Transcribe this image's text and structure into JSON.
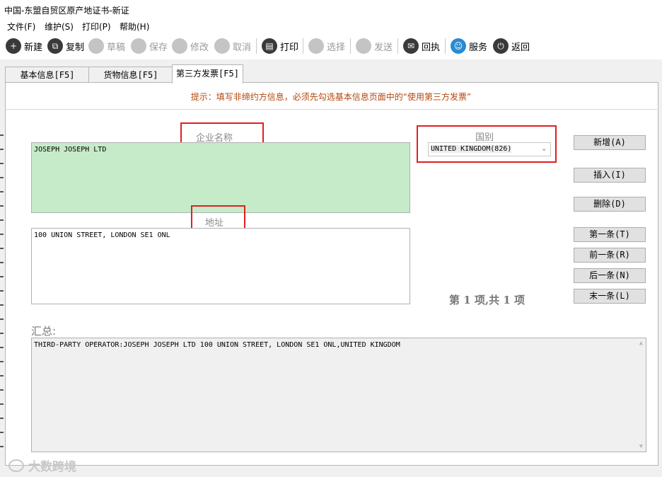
{
  "window": {
    "title": "中国-东盟自贸区原产地证书-新证"
  },
  "menu": [
    "文件(F)",
    "维护(S)",
    "打印(P)",
    "帮助(H)"
  ],
  "toolbar": {
    "new": "新建",
    "copy": "复制",
    "draft": "草稿",
    "save": "保存",
    "edit": "修改",
    "cancel": "取消",
    "print": "打印",
    "select": "选择",
    "send": "发送",
    "receipt": "回执",
    "service": "服务",
    "back": "返回"
  },
  "tabs": [
    "基本信息[F5]",
    "货物信息[F5]",
    "第三方发票[F5]"
  ],
  "hint": "提示：填写非缔约方信息，必须先勾选基本信息页面中的“使用第三方发票”",
  "form": {
    "company_label": "企业名称",
    "company_value": "JOSEPH JOSEPH LTD",
    "address_label": "地址",
    "address_value": "100 UNION STREET, LONDON SE1 ONL",
    "country_label": "国别",
    "country_value": "UNITED KINGDOM(826)"
  },
  "buttons": {
    "add": "新增(A)",
    "insert": "插入(I)",
    "delete": "删除(D)",
    "first": "第一条(T)",
    "prev": "前一条(R)",
    "next": "后一条(N)",
    "last": "末一条(L)"
  },
  "pager": "第 1 项,共 1 项",
  "summary": {
    "label": "汇总:",
    "value": "THIRD-PARTY OPERATOR:JOSEPH JOSEPH LTD 100 UNION STREET, LONDON SE1 ONL,UNITED KINGDOM"
  },
  "watermark": "大数跨境"
}
